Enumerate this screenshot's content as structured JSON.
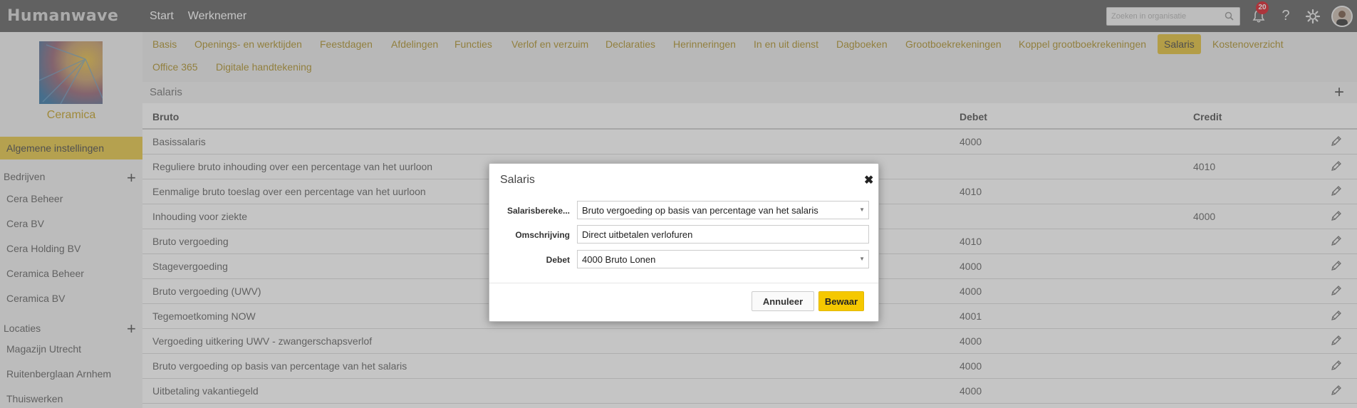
{
  "header": {
    "logo": "Humanwave",
    "nav": [
      "Start",
      "Werknemer"
    ],
    "search_placeholder": "Zoeken in organisatie",
    "notification_count": "20",
    "help_glyph": "?"
  },
  "sidebar": {
    "org_name": "Ceramica",
    "active_item": "Algemene instellingen",
    "bedrijven_label": "Bedrijven",
    "bedrijven": [
      "Cera Beheer",
      "Cera BV",
      "Cera Holding BV",
      "Ceramica Beheer",
      "Ceramica BV"
    ],
    "locaties_label": "Locaties",
    "locaties": [
      "Magazijn Utrecht",
      "Ruitenberglaan Arnhem",
      "Thuiswerken"
    ],
    "plus_glyph": "+"
  },
  "tabs": [
    "Basis",
    "Openings- en werktijden",
    "Feestdagen",
    "Afdelingen",
    "Functies",
    "Verlof en verzuim",
    "Declaraties",
    "Herinneringen",
    "In en uit dienst",
    "Dagboeken",
    "Grootboekrekeningen",
    "Koppel grootboekrekeningen",
    "Salaris",
    "Kostenoverzicht",
    "Office 365",
    "Digitale handtekening"
  ],
  "active_tab": "Salaris",
  "main": {
    "title": "Salaris",
    "add_glyph": "+",
    "columns": {
      "name": "Bruto",
      "debet": "Debet",
      "credit": "Credit"
    },
    "rows": [
      {
        "name": "Basissalaris",
        "debet": "4000",
        "credit": ""
      },
      {
        "name": "Reguliere bruto inhouding over een percentage van het uurloon",
        "debet": "",
        "credit": "4010"
      },
      {
        "name": "Eenmalige bruto toeslag over een percentage van het uurloon",
        "debet": "4010",
        "credit": ""
      },
      {
        "name": "Inhouding voor ziekte",
        "debet": "",
        "credit": "4000"
      },
      {
        "name": "Bruto vergoeding",
        "debet": "4010",
        "credit": ""
      },
      {
        "name": "Stagevergoeding",
        "debet": "4000",
        "credit": ""
      },
      {
        "name": "Bruto vergoeding (UWV)",
        "debet": "4000",
        "credit": ""
      },
      {
        "name": "Tegemoetkoming NOW",
        "debet": "4001",
        "credit": ""
      },
      {
        "name": "Vergoeding uitkering UWV - zwangerschapsverlof",
        "debet": "4000",
        "credit": ""
      },
      {
        "name": "Bruto vergoeding op basis van percentage van het salaris",
        "debet": "4000",
        "credit": ""
      },
      {
        "name": "Uitbetaling vakantiegeld",
        "debet": "4000",
        "credit": ""
      }
    ]
  },
  "modal": {
    "title": "Salaris",
    "close_glyph": "✖",
    "fields": {
      "salarisberekening_label": "Salarisbereke...",
      "salarisberekening_value": "Bruto vergoeding op basis van percentage van het salaris",
      "omschrijving_label": "Omschrijving",
      "omschrijving_value": "Direct uitbetalen verlofuren",
      "debet_label": "Debet",
      "debet_value": "4000 Bruto Lonen"
    },
    "cancel_label": "Annuleer",
    "save_label": "Bewaar"
  },
  "colors": {
    "header_bg": "#666666",
    "accent_yellow": "#e3c23e",
    "tab_text": "#b09430",
    "save_button": "#f5c800",
    "badge_red": "#d9232d"
  }
}
